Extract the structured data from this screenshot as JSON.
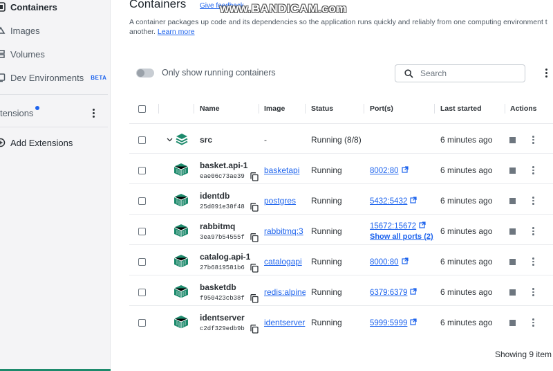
{
  "sidebar": {
    "items": [
      {
        "label": "Containers",
        "icon": "containers-icon",
        "active": true
      },
      {
        "label": "Images",
        "icon": "images-icon"
      },
      {
        "label": "Volumes",
        "icon": "volumes-icon"
      },
      {
        "label": "Dev Environments",
        "icon": "dev-environments-icon",
        "badge": "BETA"
      }
    ],
    "extensions_label": "tensions",
    "add_extensions_label": "Add Extensions"
  },
  "header": {
    "title": "Containers",
    "feedback_label": "Give feedback",
    "description_line1": "A container packages up code and its dependencies so the application runs quickly and reliably from one computing environment t",
    "description_line2": "another.",
    "learn_more": "Learn more"
  },
  "toolbar": {
    "toggle_label": "Only show running containers",
    "toggle_on": false,
    "search_placeholder": "Search"
  },
  "table": {
    "columns": [
      "Name",
      "Image",
      "Status",
      "Port(s)",
      "Last started",
      "Actions"
    ],
    "group": {
      "name": "src",
      "image": "-",
      "status": "Running (8/8)",
      "last_started": "6 minutes ago"
    },
    "rows": [
      {
        "name": "basket.api-1",
        "id": "eae06c73ae39",
        "image": "basketapi",
        "status": "Running",
        "port": "8002:80",
        "last_started": "6 minutes ago"
      },
      {
        "name": "identdb",
        "id": "25d091e38f48",
        "image": "postgres",
        "status": "Running",
        "port": "5432:5432",
        "last_started": "6 minutes ago"
      },
      {
        "name": "rabbitmq",
        "id": "3ea97b54555f",
        "image": "rabbitmq:3",
        "status": "Running",
        "port": "15672:15672",
        "show_all_ports": "Show all ports (2)",
        "last_started": "6 minutes ago"
      },
      {
        "name": "catalog.api-1",
        "id": "27b6819581b6",
        "image": "catalogapi",
        "status": "Running",
        "port": "8000:80",
        "last_started": "6 minutes ago"
      },
      {
        "name": "basketdb",
        "id": "f950423cb38f",
        "image": "redis:alpine",
        "status": "Running",
        "port": "6379:6379",
        "last_started": "6 minutes ago"
      },
      {
        "name": "identserver",
        "id": "c2df329edb9b",
        "image": "identserver",
        "status": "Running",
        "port": "5999:5999",
        "last_started": "6 minutes ago"
      }
    ]
  },
  "footer": {
    "showing": "Showing 9 item"
  },
  "watermark": "www.BANDICAM.com",
  "colors": {
    "accent": "#1d63ed",
    "container_icon": "#1d8a6c",
    "sidebar_bg": "#f4f4f6"
  }
}
